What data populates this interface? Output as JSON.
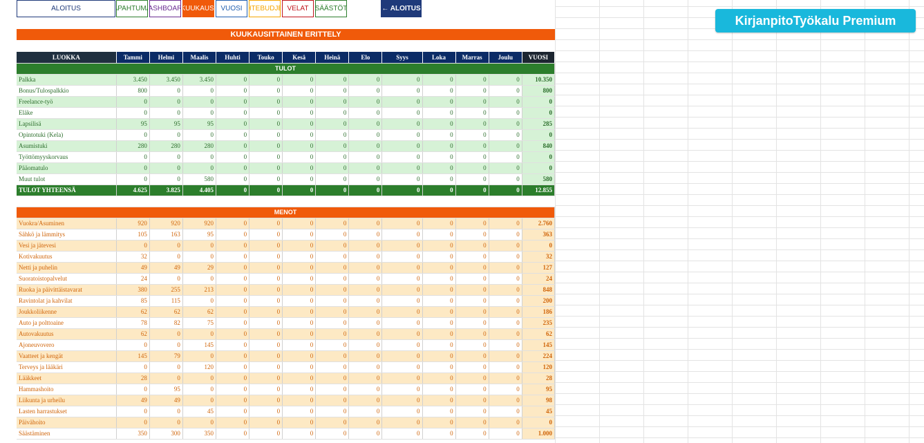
{
  "nav": {
    "tabs": [
      {
        "label": "ALOITUS",
        "color": "#1f3a7a"
      },
      {
        "label": "TAPAHTUMAT",
        "color": "#2c7e2c"
      },
      {
        "label": "DASHBOARD",
        "color": "#6a2c91"
      },
      {
        "label": "KUUKAUSI",
        "color": "#f05a0a"
      },
      {
        "label": "VUOSI",
        "color": "#1f5fb0"
      },
      {
        "label": "KOHTEBUDJETTI",
        "color": "#f5a500"
      },
      {
        "label": "VELAT",
        "color": "#c0141c"
      },
      {
        "label": "SÄÄSTÖT",
        "color": "#2c7e2c"
      }
    ],
    "back_button": "← ALOITUS"
  },
  "brand": "KirjanpitoTyökalu Premium",
  "title": "KUUKAUSITTAINEN ERITTELY",
  "header": {
    "category": "LUOKKA",
    "months": [
      "Tammi",
      "Helmi",
      "Maalis",
      "Huhti",
      "Touko",
      "Kesä",
      "Heinä",
      "Elo",
      "Syys",
      "Loka",
      "Marras",
      "Joulu"
    ],
    "year": "VUOSI"
  },
  "income": {
    "section": "TULOT",
    "rows": [
      {
        "label": "Palkka",
        "values": [
          "3.450",
          "3.450",
          "3.450",
          "0",
          "0",
          "0",
          "0",
          "0",
          "0",
          "0",
          "0",
          "0"
        ],
        "year": "10.350"
      },
      {
        "label": "Bonus/Tulospalkkio",
        "values": [
          "800",
          "0",
          "0",
          "0",
          "0",
          "0",
          "0",
          "0",
          "0",
          "0",
          "0",
          "0"
        ],
        "year": "800"
      },
      {
        "label": "Freelance-työ",
        "values": [
          "0",
          "0",
          "0",
          "0",
          "0",
          "0",
          "0",
          "0",
          "0",
          "0",
          "0",
          "0"
        ],
        "year": "0"
      },
      {
        "label": "Eläke",
        "values": [
          "0",
          "0",
          "0",
          "0",
          "0",
          "0",
          "0",
          "0",
          "0",
          "0",
          "0",
          "0"
        ],
        "year": "0"
      },
      {
        "label": "Lapsilisä",
        "values": [
          "95",
          "95",
          "95",
          "0",
          "0",
          "0",
          "0",
          "0",
          "0",
          "0",
          "0",
          "0"
        ],
        "year": "285"
      },
      {
        "label": "Opintotuki (Kela)",
        "values": [
          "0",
          "0",
          "0",
          "0",
          "0",
          "0",
          "0",
          "0",
          "0",
          "0",
          "0",
          "0"
        ],
        "year": "0"
      },
      {
        "label": "Asumistuki",
        "values": [
          "280",
          "280",
          "280",
          "0",
          "0",
          "0",
          "0",
          "0",
          "0",
          "0",
          "0",
          "0"
        ],
        "year": "840"
      },
      {
        "label": "Työttömyyskorvaus",
        "values": [
          "0",
          "0",
          "0",
          "0",
          "0",
          "0",
          "0",
          "0",
          "0",
          "0",
          "0",
          "0"
        ],
        "year": "0"
      },
      {
        "label": "Pääomatulo",
        "values": [
          "0",
          "0",
          "0",
          "0",
          "0",
          "0",
          "0",
          "0",
          "0",
          "0",
          "0",
          "0"
        ],
        "year": "0"
      },
      {
        "label": "Muut tulot",
        "values": [
          "0",
          "0",
          "580",
          "0",
          "0",
          "0",
          "0",
          "0",
          "0",
          "0",
          "0",
          "0"
        ],
        "year": "580"
      }
    ],
    "total": {
      "label": "TULOT YHTEENSÄ",
      "values": [
        "4.625",
        "3.825",
        "4.405",
        "0",
        "0",
        "0",
        "0",
        "0",
        "0",
        "0",
        "0",
        "0"
      ],
      "year": "12.855"
    }
  },
  "expenses": {
    "section": "MENOT",
    "rows": [
      {
        "label": "Vuokra/Asuminen",
        "values": [
          "920",
          "920",
          "920",
          "0",
          "0",
          "0",
          "0",
          "0",
          "0",
          "0",
          "0",
          "0"
        ],
        "year": "2.760"
      },
      {
        "label": "Sähkö ja lämmitys",
        "values": [
          "105",
          "163",
          "95",
          "0",
          "0",
          "0",
          "0",
          "0",
          "0",
          "0",
          "0",
          "0"
        ],
        "year": "363"
      },
      {
        "label": "Vesi ja jätevesi",
        "values": [
          "0",
          "0",
          "0",
          "0",
          "0",
          "0",
          "0",
          "0",
          "0",
          "0",
          "0",
          "0"
        ],
        "year": "0"
      },
      {
        "label": "Kotivakuutus",
        "values": [
          "32",
          "0",
          "0",
          "0",
          "0",
          "0",
          "0",
          "0",
          "0",
          "0",
          "0",
          "0"
        ],
        "year": "32"
      },
      {
        "label": "Netti ja puhelin",
        "values": [
          "49",
          "49",
          "29",
          "0",
          "0",
          "0",
          "0",
          "0",
          "0",
          "0",
          "0",
          "0"
        ],
        "year": "127"
      },
      {
        "label": "Suoratoistopalvelut",
        "values": [
          "24",
          "0",
          "0",
          "0",
          "0",
          "0",
          "0",
          "0",
          "0",
          "0",
          "0",
          "0"
        ],
        "year": "24"
      },
      {
        "label": "Ruoka ja päivittäistavarat",
        "values": [
          "380",
          "255",
          "213",
          "0",
          "0",
          "0",
          "0",
          "0",
          "0",
          "0",
          "0",
          "0"
        ],
        "year": "848"
      },
      {
        "label": "Ravintolat ja kahvilat",
        "values": [
          "85",
          "115",
          "0",
          "0",
          "0",
          "0",
          "0",
          "0",
          "0",
          "0",
          "0",
          "0"
        ],
        "year": "200"
      },
      {
        "label": "Joukkoliikenne",
        "values": [
          "62",
          "62",
          "62",
          "0",
          "0",
          "0",
          "0",
          "0",
          "0",
          "0",
          "0",
          "0"
        ],
        "year": "186"
      },
      {
        "label": "Auto ja polttoaine",
        "values": [
          "78",
          "82",
          "75",
          "0",
          "0",
          "0",
          "0",
          "0",
          "0",
          "0",
          "0",
          "0"
        ],
        "year": "235"
      },
      {
        "label": "Autovakuutus",
        "values": [
          "62",
          "0",
          "0",
          "0",
          "0",
          "0",
          "0",
          "0",
          "0",
          "0",
          "0",
          "0"
        ],
        "year": "62"
      },
      {
        "label": "Ajoneuvovero",
        "values": [
          "0",
          "0",
          "145",
          "0",
          "0",
          "0",
          "0",
          "0",
          "0",
          "0",
          "0",
          "0"
        ],
        "year": "145"
      },
      {
        "label": "Vaatteet ja kengät",
        "values": [
          "145",
          "79",
          "0",
          "0",
          "0",
          "0",
          "0",
          "0",
          "0",
          "0",
          "0",
          "0"
        ],
        "year": "224"
      },
      {
        "label": "Terveys ja lääkäri",
        "values": [
          "0",
          "0",
          "120",
          "0",
          "0",
          "0",
          "0",
          "0",
          "0",
          "0",
          "0",
          "0"
        ],
        "year": "120"
      },
      {
        "label": "Lääkkeet",
        "values": [
          "28",
          "0",
          "0",
          "0",
          "0",
          "0",
          "0",
          "0",
          "0",
          "0",
          "0",
          "0"
        ],
        "year": "28"
      },
      {
        "label": "Hammashoito",
        "values": [
          "0",
          "95",
          "0",
          "0",
          "0",
          "0",
          "0",
          "0",
          "0",
          "0",
          "0",
          "0"
        ],
        "year": "95"
      },
      {
        "label": "Liikunta ja urheilu",
        "values": [
          "49",
          "49",
          "0",
          "0",
          "0",
          "0",
          "0",
          "0",
          "0",
          "0",
          "0",
          "0"
        ],
        "year": "98"
      },
      {
        "label": "Lasten harrastukset",
        "values": [
          "0",
          "0",
          "45",
          "0",
          "0",
          "0",
          "0",
          "0",
          "0",
          "0",
          "0",
          "0"
        ],
        "year": "45"
      },
      {
        "label": "Päivähoito",
        "values": [
          "0",
          "0",
          "0",
          "0",
          "0",
          "0",
          "0",
          "0",
          "0",
          "0",
          "0",
          "0"
        ],
        "year": "0"
      },
      {
        "label": "Säästäminen",
        "values": [
          "350",
          "300",
          "350",
          "0",
          "0",
          "0",
          "0",
          "0",
          "0",
          "0",
          "0",
          "0"
        ],
        "year": "1.000"
      }
    ]
  }
}
